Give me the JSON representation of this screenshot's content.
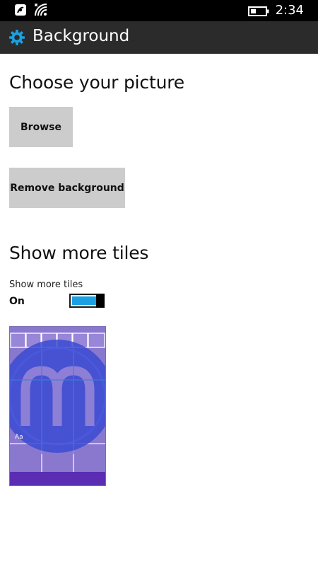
{
  "status_bar": {
    "time": "2:34",
    "icons": [
      "nfc-icon",
      "wifi-icon",
      "battery-icon"
    ]
  },
  "header": {
    "title": "Background",
    "icon": "gear-icon",
    "accent_color": "#1ba1e2"
  },
  "picture_section": {
    "title": "Choose your picture",
    "browse_label": "Browse",
    "remove_label": "Remove background"
  },
  "tiles_section": {
    "title": "Show more tiles",
    "toggle_label": "Show more tiles",
    "toggle_state": "On",
    "toggle_on": true
  },
  "preview": {
    "tile_text": "Aa",
    "background_color": "#8a78cf",
    "logo_color": "#3a4bd1"
  }
}
